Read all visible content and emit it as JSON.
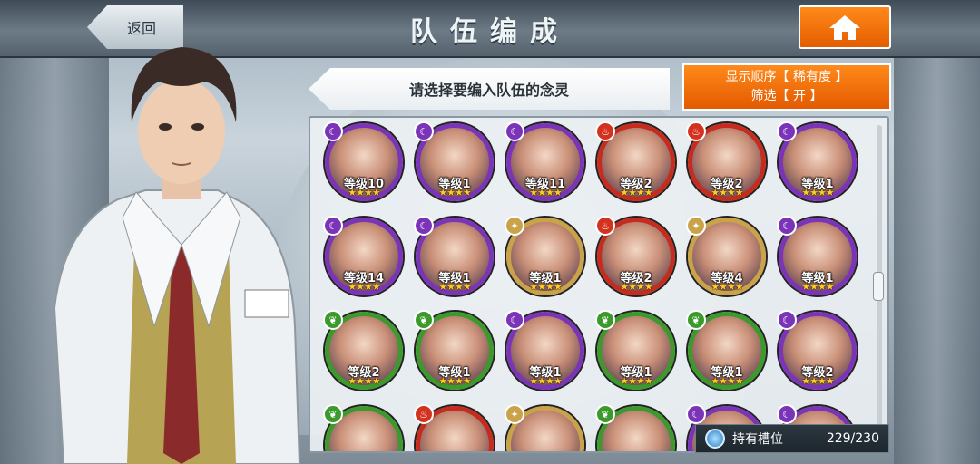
{
  "header": {
    "back_label": "返回",
    "title": "队伍编成",
    "home_icon": "home-icon"
  },
  "instruction": "请选择要编入队伍的念灵",
  "sort": {
    "line1": "显示顺序【 稀有度 】",
    "line2": "筛选【 开 】"
  },
  "slots": {
    "label": "持有槽位",
    "count": "229/230"
  },
  "colors": {
    "accent_orange": "#f07a10",
    "purple": "#7b33b8",
    "red": "#c62b1d",
    "green": "#3c9a2c",
    "gold": "#c9a24a"
  },
  "units": [
    {
      "element": "purple",
      "level": "等级10",
      "stars": "★★★★"
    },
    {
      "element": "purple",
      "level": "等级1",
      "stars": "★★★★"
    },
    {
      "element": "purple",
      "level": "等级11",
      "stars": "★★★★"
    },
    {
      "element": "red",
      "level": "等级2",
      "stars": "★★★★"
    },
    {
      "element": "red",
      "level": "等级2",
      "stars": "★★★★"
    },
    {
      "element": "purple",
      "level": "等级1",
      "stars": "★★★★"
    },
    {
      "element": "purple",
      "level": "等级14",
      "stars": "★★★★"
    },
    {
      "element": "purple",
      "level": "等级1",
      "stars": "★★★★"
    },
    {
      "element": "gold",
      "level": "等级1",
      "stars": "★★★★"
    },
    {
      "element": "red",
      "level": "等级2",
      "stars": "★★★★"
    },
    {
      "element": "gold",
      "level": "等级4",
      "stars": "★★★★"
    },
    {
      "element": "purple",
      "level": "等级1",
      "stars": "★★★★"
    },
    {
      "element": "green",
      "level": "等级2",
      "stars": "★★★★"
    },
    {
      "element": "green",
      "level": "等级1",
      "stars": "★★★★"
    },
    {
      "element": "purple",
      "level": "等级1",
      "stars": "★★★★"
    },
    {
      "element": "green",
      "level": "等级1",
      "stars": "★★★★"
    },
    {
      "element": "green",
      "level": "等级1",
      "stars": "★★★★"
    },
    {
      "element": "purple",
      "level": "等级2",
      "stars": "★★★★"
    },
    {
      "element": "green",
      "level": "",
      "stars": ""
    },
    {
      "element": "red",
      "level": "",
      "stars": ""
    },
    {
      "element": "gold",
      "level": "",
      "stars": ""
    },
    {
      "element": "green",
      "level": "",
      "stars": ""
    },
    {
      "element": "purple",
      "level": "",
      "stars": ""
    },
    {
      "element": "purple",
      "level": "",
      "stars": ""
    }
  ]
}
